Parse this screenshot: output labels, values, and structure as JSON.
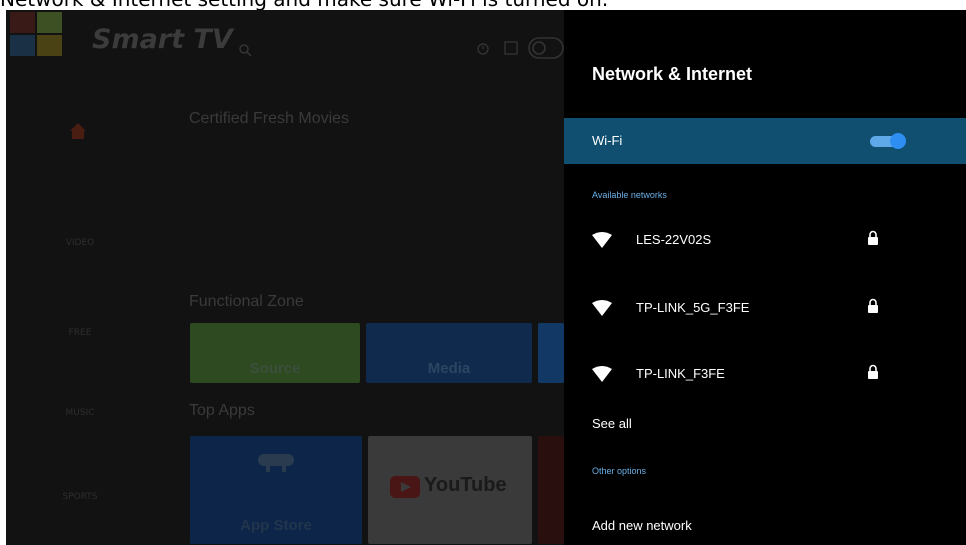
{
  "caption": {
    "text": "Network & Internet setting and make sure Wi-Fi is turned on."
  },
  "brand": {
    "name": "Smart TV"
  },
  "sidebar": {
    "items": [
      {
        "label": "VIDEO"
      },
      {
        "label": "FREE"
      },
      {
        "label": "MUSIC"
      },
      {
        "label": "SPORTS"
      }
    ]
  },
  "main": {
    "sections": {
      "certified": "Certified Fresh Movies",
      "functional": "Functional Zone",
      "top_apps": "Top Apps"
    },
    "tiles": {
      "source": "Source",
      "media": "Media",
      "app_store": "App Store",
      "youtube": "YouTube"
    }
  },
  "panel": {
    "title": "Network & Internet",
    "wifi": {
      "label": "Wi-Fi",
      "enabled": true
    },
    "available_heading": "Available networks",
    "networks": [
      {
        "name": "LES-22V02S",
        "secured": true
      },
      {
        "name": "TP-LINK_5G_F3FE",
        "secured": true
      },
      {
        "name": "TP-LINK_F3FE",
        "secured": true
      }
    ],
    "see_all": "See all",
    "other_heading": "Other options",
    "add_network": "Add new network"
  },
  "colors": {
    "highlight_row": "#104f70",
    "toggle_on": "#2f8ef2",
    "subheading": "#6ab0e8",
    "panel_bg": "#000000"
  },
  "icons": {
    "wifi": "wifi-icon",
    "lock": "lock-icon",
    "home": "home-icon",
    "search": "search-icon"
  }
}
